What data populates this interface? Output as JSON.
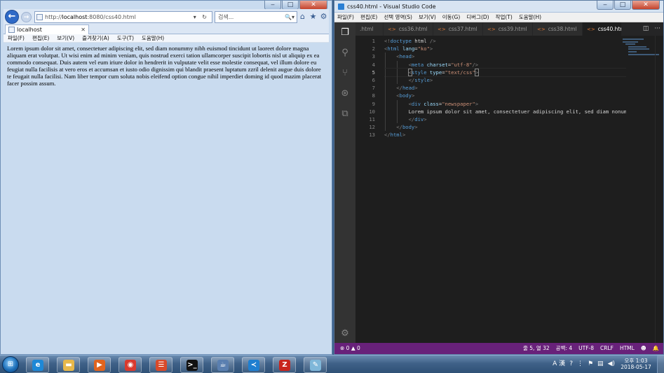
{
  "ie": {
    "address": {
      "prefix": "http://",
      "host": "localhost",
      "path": ":8080/css40.html",
      "controls": "▾ ↻"
    },
    "search": {
      "placeholder": "검색...",
      "controls": "🔍▾"
    },
    "tab": {
      "title": "localhost"
    },
    "menu": [
      "파일(F)",
      "편집(E)",
      "보기(V)",
      "즐겨찾기(A)",
      "도구(T)",
      "도움말(H)"
    ],
    "content_text": "Lorem ipsum dolor sit amet, consectetuer adipiscing elit, sed diam nonummy nibh euismod tincidunt ut laoreet dolore magna aliquam erat volutpat. Ut wisi enim ad minim veniam, quis nostrud exerci tation ullamcorper suscipit lobortis nisl ut aliquip ex ea commodo consequat. Duis autem vel eum iriure dolor in hendrerit in vulputate velit esse molestie consequat, vel illum dolore eu feugiat nulla facilisis at vero eros et accumsan et iusto odio dignissim qui blandit praesent luptatum zzril delenit augue duis dolore te feugait nulla facilisi. Nam liber tempor cum soluta nobis eleifend option congue nihil imperdiet doming id quod mazim placerat facer possim assum."
  },
  "vscode": {
    "title": "css40.html - Visual Studio Code",
    "menu": [
      "파일(F)",
      "편집(E)",
      "선택 영역(S)",
      "보기(V)",
      "이동(G)",
      "디버그(D)",
      "작업(T)",
      "도움말(H)"
    ],
    "tabs": [
      {
        "label": ".html",
        "icon": "html-file-icon"
      },
      {
        "label": "css36.html",
        "icon": "html-file-icon"
      },
      {
        "label": "css37.html",
        "icon": "html-file-icon"
      },
      {
        "label": "css39.html",
        "icon": "html-file-icon"
      },
      {
        "label": "css38.html",
        "icon": "html-file-icon"
      },
      {
        "label": "css40.html",
        "icon": "html-file-icon",
        "active": true
      }
    ],
    "tab_actions": {
      "split": "◫",
      "more": "···"
    },
    "line_numbers": [
      "1",
      "2",
      "3",
      "4",
      "5",
      "6",
      "7",
      "8",
      "9",
      "10",
      "11",
      "12",
      "13"
    ],
    "current_line": 5,
    "status": {
      "left": "⊗ 0 ▲ 0",
      "position": "줄 5, 열 32",
      "spaces": "공백: 4",
      "encoding": "UTF-8",
      "eol": "CRLF",
      "language": "HTML",
      "feedback": "☻",
      "bell": "🔔"
    }
  },
  "taskbar": {
    "apps": [
      {
        "name": "ie-app",
        "glyph": "e",
        "color": "#1e88d6"
      },
      {
        "name": "explorer-app",
        "glyph": "▬",
        "color": "#e7b84a"
      },
      {
        "name": "media-player-app",
        "glyph": "▶",
        "color": "#e0641f"
      },
      {
        "name": "chrome-app",
        "glyph": "◉",
        "color": "#d93a2e"
      },
      {
        "name": "acrobat-app",
        "glyph": "☰",
        "color": "#d94a2a"
      },
      {
        "name": "cmd-app",
        "glyph": ">_",
        "color": "#111111"
      },
      {
        "name": "java-app",
        "glyph": "☕",
        "color": "#5a7fb0"
      },
      {
        "name": "vscode-app",
        "glyph": "≺",
        "color": "#1f7fd0"
      },
      {
        "name": "filezilla-app",
        "glyph": "Z",
        "color": "#c8261e"
      },
      {
        "name": "notepad-app",
        "glyph": "✎",
        "color": "#7fb7d9"
      }
    ],
    "clock": {
      "time": "오후 1:03",
      "date": "2018-05-17"
    },
    "tray": {
      "lang": "A 漢",
      "help": "?",
      "misc": "⋮"
    }
  }
}
